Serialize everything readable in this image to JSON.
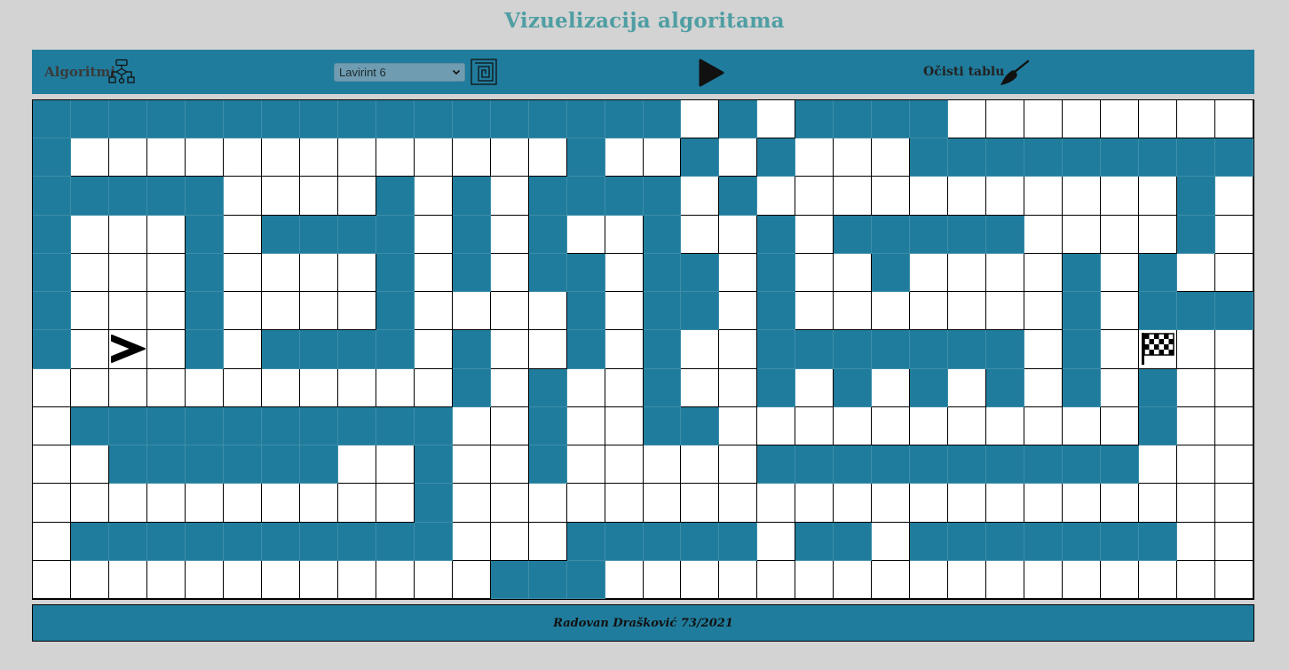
{
  "title": "Vizuelizacija algoritama",
  "toolbar": {
    "algorithms_label": "Algoritmi",
    "algorithms_icon": "flowchart-icon",
    "maze_select_value": "Lavirint 6",
    "maze_icon": "maze-icon",
    "play_icon": "play-icon",
    "clear_label": "Očisti tablu",
    "clear_icon": "broom-icon"
  },
  "grid": {
    "rows": 13,
    "cols": 32,
    "wall_color": "#207c9c",
    "start_icon": "start-arrow-icon",
    "finish_icon": "checkered-flag-icon",
    "cells": [
      "#################.#.####........",
      "#.............#..#.#...#########..",
      "#####....#.#.####.#...........#..",
      "#...#.####.#.#..#..#.#####....#..",
      "#...#....#.#.##.##.#..#....#.#...",
      "#...#....#....#.##.#.......#.###..",
      "#.S.#.####.#..#.#..#######.#.F..",
      "...........#.#..#..#.#.#.#.#.#..",
      ".##########..#..##...........#...",
      "..######..#..#.....##########..",
      "..........#.....................",
      ".##########...#####.##.#######..",
      "............###................."
    ]
  },
  "footer": {
    "text": "Radovan Drašković 73/2021"
  }
}
